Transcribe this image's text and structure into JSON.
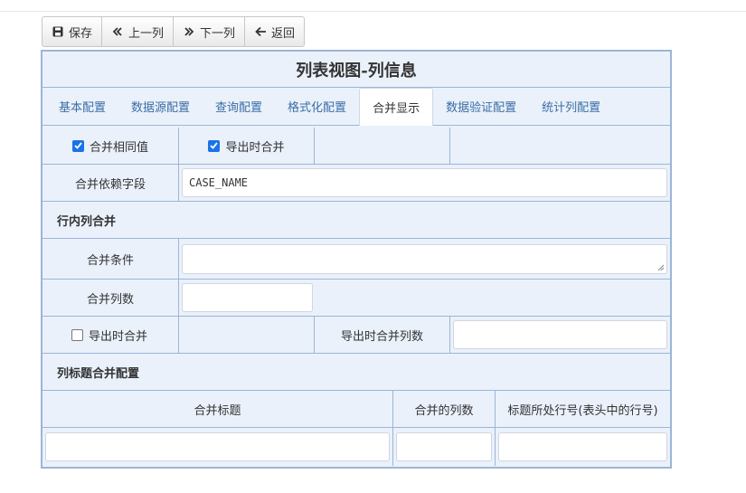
{
  "toolbar": {
    "save": "保存",
    "prev": "上一列",
    "next": "下一列",
    "back": "返回",
    "icons": [
      "save-icon",
      "double-left-icon",
      "double-right-icon",
      "arrow-left-icon"
    ]
  },
  "panel": {
    "title": "列表视图-列信息",
    "tabs": [
      "基本配置",
      "数据源配置",
      "查询配置",
      "格式化配置",
      "合并显示",
      "数据验证配置",
      "统计列配置"
    ],
    "active_tab": "合并显示"
  },
  "form": {
    "merge_same": {
      "label": "合并相同值",
      "checked": true
    },
    "export_merge": {
      "label": "导出时合并",
      "checked": true
    },
    "depend_field": {
      "label": "合并依赖字段",
      "value": "CASE_NAME"
    },
    "inrow_section": "行内列合并",
    "merge_condition": {
      "label": "合并条件",
      "value": ""
    },
    "merge_cols": {
      "label": "合并列数",
      "value": ""
    },
    "export_merge2": {
      "label": "导出时合并",
      "checked": false
    },
    "export_merge_cols": {
      "label": "导出时合并列数",
      "value": ""
    },
    "title_section": "列标题合并配置",
    "title_table": {
      "headers": [
        "合并标题",
        "合并的列数",
        "标题所处行号(表头中的行号)"
      ],
      "values": [
        "",
        "",
        ""
      ]
    }
  },
  "colors": {
    "border": "#9db5d6",
    "panel_bg": "#eaf1fb",
    "link": "#3a6ea5",
    "checkbox": "#1a73e8"
  }
}
